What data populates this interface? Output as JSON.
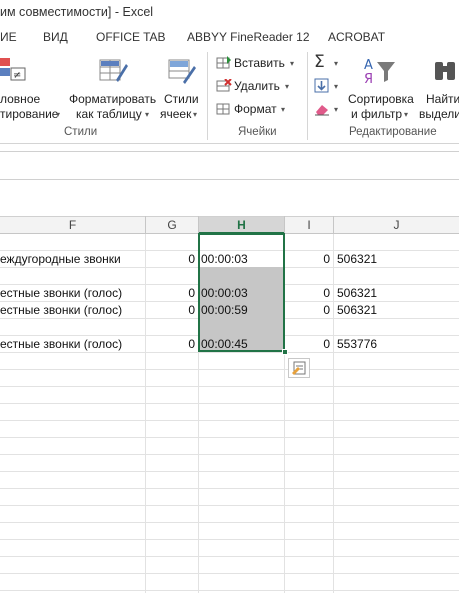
{
  "window": {
    "title": "им совместимости] - Excel"
  },
  "ribbon_tabs": [
    "ИЕ",
    "ВИД",
    "OFFICE TAB",
    "ABBYY FineReader 12",
    "ACROBAT"
  ],
  "styles_group": {
    "cond_format": {
      "line1": "ловное",
      "line2": "тирование"
    },
    "format_as_table": {
      "line1": "Форматировать",
      "line2": "как таблицу"
    },
    "cell_styles": {
      "line1": "Стили",
      "line2": "ячеек"
    },
    "label": "Стили"
  },
  "cells_group": {
    "insert": "Вставить",
    "delete": "Удалить",
    "format": "Формат",
    "label": "Ячейки"
  },
  "editing_group": {
    "sort_filter": {
      "line1": "Сортировка",
      "line2": "и фильтр"
    },
    "find_select": {
      "line1": "Найти",
      "line2": "выдели"
    },
    "label": "Редактирование"
  },
  "columns": [
    "F",
    "G",
    "H",
    "I",
    "J"
  ],
  "rows": [
    {
      "f": "еждугородные звонки",
      "g": "0",
      "h": "00:00:03",
      "i": "0",
      "j": "506321"
    },
    {
      "f": "естные звонки (голос)",
      "g": "0",
      "h": "00:00:03",
      "i": "0",
      "j": "506321"
    },
    {
      "f": "естные звонки (голос)",
      "g": "0",
      "h": "00:00:59",
      "i": "0",
      "j": "506321"
    },
    {
      "f": "естные звонки (голос)",
      "g": "0",
      "h": "00:00:45",
      "i": "0",
      "j": "553776"
    }
  ],
  "colors": {
    "accent": "#217346",
    "selection_fill": "#c6c6c6"
  }
}
